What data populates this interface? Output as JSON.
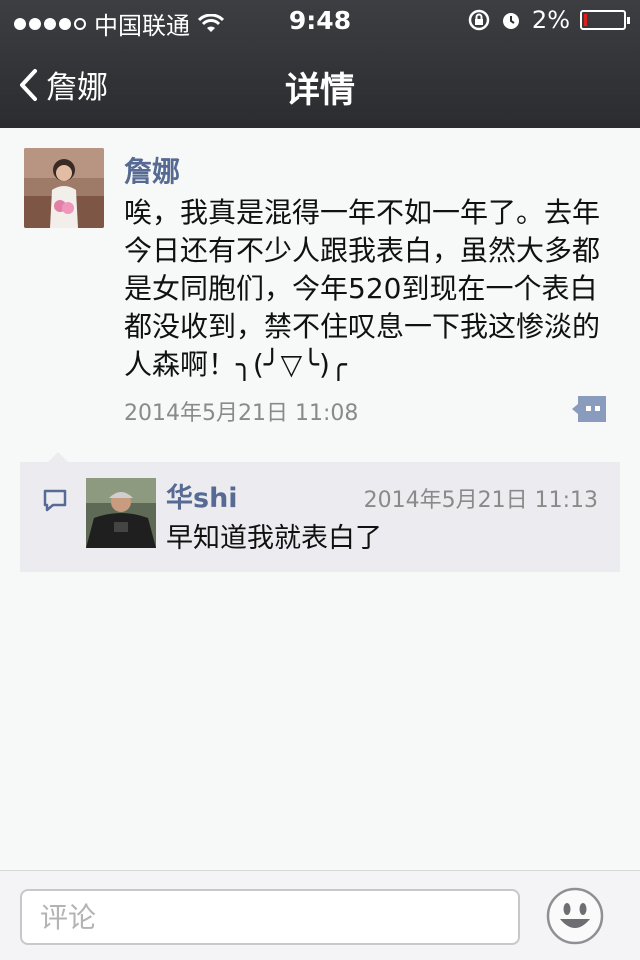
{
  "status_bar": {
    "carrier": "中国联通",
    "time": "9:48",
    "battery": "2%"
  },
  "nav": {
    "back_label": "詹娜",
    "title": "详情"
  },
  "post": {
    "author": "詹娜",
    "content": "唉，我真是混得一年不如一年了。去年今日还有不少人跟我表白，虽然大多都是女同胞们，今年520到现在一个表白都没收到，禁不住叹息一下我这惨淡的人森啊！╮(╯▽╰)╭",
    "time": "2014年5月21日 11:08"
  },
  "comments": [
    {
      "author": "华shi",
      "time": "2014年5月21日 11:13",
      "text": "早知道我就表白了"
    }
  ],
  "input": {
    "placeholder": "评论"
  },
  "colors": {
    "link_blue": "#566a93",
    "nav_bg": "#2b2c2f",
    "page_bg": "#f7f8f8",
    "comment_bg": "#ececf0"
  },
  "icons": {
    "wifi": "wifi-icon",
    "lock_rotation": "rotation-lock-icon",
    "alarm": "alarm-icon",
    "more": "more-options-icon",
    "comment": "comment-icon",
    "emoji": "emoji-icon"
  }
}
